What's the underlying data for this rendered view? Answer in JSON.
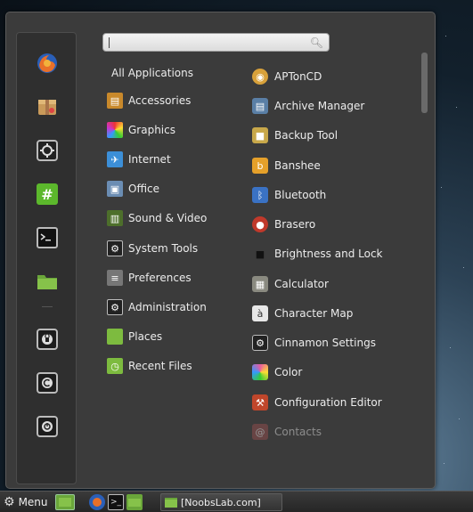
{
  "search": {
    "placeholder": "",
    "value": ""
  },
  "favorites": [
    {
      "icon": "firefox-icon"
    },
    {
      "icon": "package-icon"
    },
    {
      "icon": "settings-icon"
    },
    {
      "icon": "hashtag-icon"
    },
    {
      "icon": "terminal-icon"
    },
    {
      "icon": "folder-icon"
    },
    {
      "icon": "lock-screen-icon"
    },
    {
      "icon": "logout-icon"
    },
    {
      "icon": "power-icon"
    }
  ],
  "categories": [
    {
      "label": "All Applications",
      "icon": ""
    },
    {
      "label": "Accessories",
      "icon": "accessories-icon",
      "color": "#c9892b"
    },
    {
      "label": "Graphics",
      "icon": "graphics-icon",
      "color": "#d93c6a"
    },
    {
      "label": "Internet",
      "icon": "internet-icon",
      "color": "#3c8fd8"
    },
    {
      "label": "Office",
      "icon": "office-icon",
      "color": "#6b8db3"
    },
    {
      "label": "Sound & Video",
      "icon": "sound-video-icon",
      "color": "#4d6f2b"
    },
    {
      "label": "System Tools",
      "icon": "system-tools-icon",
      "color": "#555555"
    },
    {
      "label": "Preferences",
      "icon": "preferences-icon",
      "color": "#777777"
    },
    {
      "label": "Administration",
      "icon": "administration-icon",
      "color": "#555555"
    },
    {
      "label": "Places",
      "icon": "places-icon",
      "color": "#7dbb3f"
    },
    {
      "label": "Recent Files",
      "icon": "recent-files-icon",
      "color": "#7dbb3f"
    }
  ],
  "apps": [
    {
      "label": "APTonCD",
      "icon": "aptoncd-icon",
      "color": "#d8a13a"
    },
    {
      "label": "Archive Manager",
      "icon": "archive-manager-icon",
      "color": "#5a7fa6"
    },
    {
      "label": "Backup Tool",
      "icon": "backup-tool-icon",
      "color": "#c8a84a"
    },
    {
      "label": "Banshee",
      "icon": "banshee-icon",
      "color": "#e5a02a"
    },
    {
      "label": "Bluetooth",
      "icon": "bluetooth-icon",
      "color": "#3a72c4"
    },
    {
      "label": "Brasero",
      "icon": "brasero-icon",
      "color": "#c0392b"
    },
    {
      "label": "Brightness and Lock",
      "icon": "brightness-lock-icon",
      "color": "#2b2b2b"
    },
    {
      "label": "Calculator",
      "icon": "calculator-icon",
      "color": "#8a8a80"
    },
    {
      "label": "Character Map",
      "icon": "character-map-icon",
      "color": "#e8e8e8"
    },
    {
      "label": "Cinnamon Settings",
      "icon": "cinnamon-settings-icon",
      "color": "#555555"
    },
    {
      "label": "Color",
      "icon": "color-icon",
      "color": "#e85aa0"
    },
    {
      "label": "Configuration Editor",
      "icon": "configuration-editor-icon",
      "color": "#c0462b"
    },
    {
      "label": "Contacts",
      "icon": "contacts-icon",
      "color": "#a05050",
      "dimmed": true
    }
  ],
  "panel": {
    "menu_label": "Menu",
    "window_title": "[NoobsLab.com]"
  }
}
